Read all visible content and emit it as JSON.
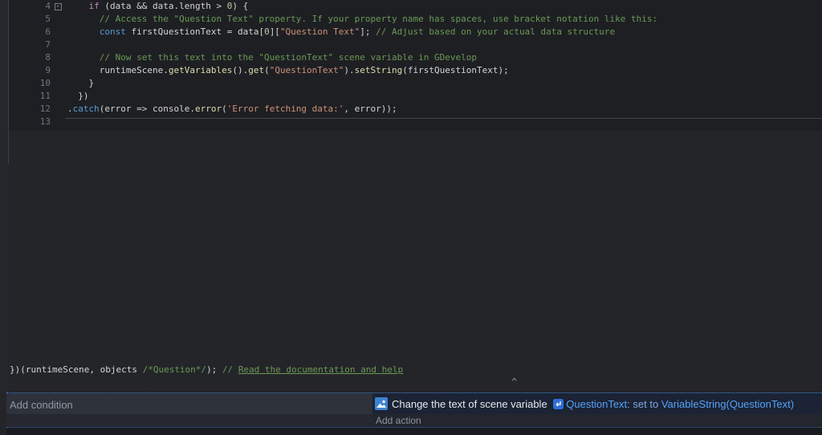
{
  "colors": {
    "editor_bg": "#1e1f23",
    "selection_border_blue": "#4b8fe2",
    "param_blue": "#55a2f7",
    "comment_green": "#6a9955",
    "string_orange": "#ce9178",
    "selected_action_bg": "#1b2335"
  },
  "editor": {
    "fold_glyph": "-",
    "lines": [
      {
        "num": "4",
        "fold": true,
        "tokens": [
          [
            "    ",
            "p"
          ],
          [
            "if",
            "k"
          ],
          [
            " (data && data.length > ",
            "p"
          ],
          [
            "0",
            "n"
          ],
          [
            ") {",
            "p"
          ]
        ]
      },
      {
        "num": "5",
        "tokens": [
          [
            "      ",
            "p"
          ],
          [
            "// Access the \"Question Text\" property. If your property name has spaces, use bracket notation like this:",
            "c"
          ]
        ]
      },
      {
        "num": "6",
        "tokens": [
          [
            "      ",
            "p"
          ],
          [
            "const",
            "b"
          ],
          [
            " firstQuestionText = data[",
            "p"
          ],
          [
            "0",
            "n"
          ],
          [
            "][",
            "p"
          ],
          [
            "\"Question Text\"",
            "s"
          ],
          [
            "]; ",
            "p"
          ],
          [
            "// Adjust based on your actual data structure",
            "c"
          ]
        ]
      },
      {
        "num": "7",
        "tokens": []
      },
      {
        "num": "8",
        "tokens": [
          [
            "      ",
            "p"
          ],
          [
            "// Now set this text into the \"QuestionText\" scene variable in GDevelop",
            "c"
          ]
        ]
      },
      {
        "num": "9",
        "tokens": [
          [
            "      ",
            "p"
          ],
          [
            "runtimeScene.",
            "p"
          ],
          [
            "getVariables",
            "f"
          ],
          [
            "().",
            "p"
          ],
          [
            "get",
            "f"
          ],
          [
            "(",
            "p"
          ],
          [
            "\"QuestionText\"",
            "s"
          ],
          [
            ").",
            "p"
          ],
          [
            "setString",
            "f"
          ],
          [
            "(firstQuestionText);",
            "p"
          ]
        ]
      },
      {
        "num": "10",
        "tokens": [
          [
            "    }",
            "p"
          ]
        ]
      },
      {
        "num": "11",
        "tokens": [
          [
            "  })",
            "p"
          ]
        ]
      },
      {
        "num": "12",
        "tokens": [
          [
            ".",
            "p"
          ],
          [
            "catch",
            "b"
          ],
          [
            "(error => console.",
            "p"
          ],
          [
            "error",
            "f"
          ],
          [
            "(",
            "p"
          ],
          [
            "'Error fetching data:'",
            "s"
          ],
          [
            ", error));",
            "p"
          ]
        ]
      },
      {
        "num": "13",
        "tokens": []
      }
    ],
    "footer": {
      "code_before": "})(runtimeScene, objects ",
      "comment_inline": "/*Question*/",
      "code_after": "); ",
      "link_prefix": "// ",
      "link_text": "Read the documentation and help"
    },
    "collapse_caret": "^"
  },
  "events_panel": {
    "add_condition_label": "Add condition",
    "add_action_label": "Add action",
    "selected_action": {
      "label": "Change the text of scene variable ",
      "variable_name": "QuestionText",
      "connector": ": set to ",
      "value_expression": "VariableString(QuestionText)"
    },
    "icons": [
      "text-variable-action-icon",
      "scene-variable-icon"
    ]
  }
}
